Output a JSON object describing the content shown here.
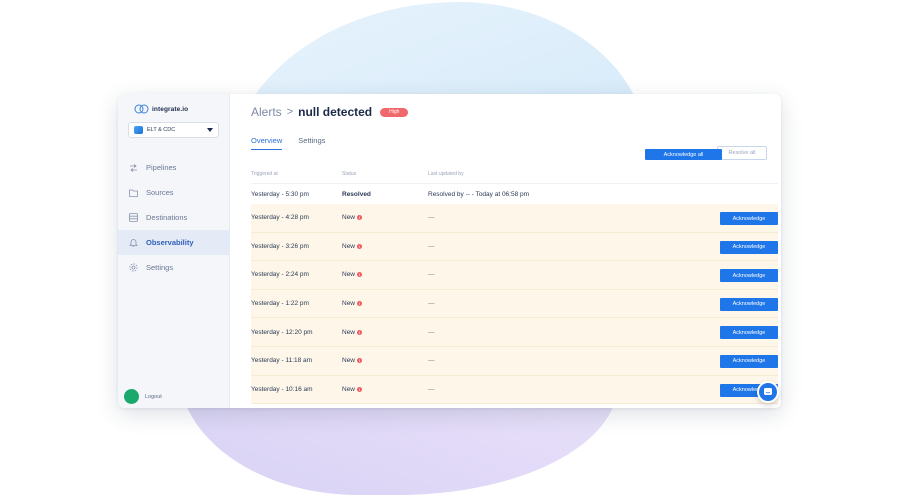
{
  "brand": {
    "logo_text": "integrate.io"
  },
  "workspace": {
    "selected": "ELT & CDC"
  },
  "sidebar": {
    "items": [
      {
        "label": "Pipelines",
        "icon": "pipelines-icon",
        "active": false
      },
      {
        "label": "Sources",
        "icon": "folder-icon",
        "active": false
      },
      {
        "label": "Destinations",
        "icon": "database-icon",
        "active": false
      },
      {
        "label": "Observability",
        "icon": "bell-icon",
        "active": true
      },
      {
        "label": "Settings",
        "icon": "gear-icon",
        "active": false
      }
    ],
    "logout_label": "Logout"
  },
  "header": {
    "breadcrumb_parent": "Alerts",
    "breadcrumb_separator": ">",
    "title": "null detected",
    "severity_badge": "High"
  },
  "tabs": [
    {
      "label": "Overview",
      "active": true
    },
    {
      "label": "Settings",
      "active": false
    }
  ],
  "actions": {
    "acknowledge_all": "Acknowledge all",
    "resolve_all": "Resolve all"
  },
  "table": {
    "columns": [
      "Triggered at",
      "Status",
      "Last updated by"
    ],
    "resolved_row": {
      "triggered_at": "Yesterday - 5:30 pm",
      "status": "Resolved",
      "last_updated_by": "Resolved by -- - Today at 06:58 pm"
    },
    "rows": [
      {
        "triggered_at": "Yesterday - 4:28 pm",
        "status": "New",
        "last_updated_by": "—",
        "action": "Acknowledge"
      },
      {
        "triggered_at": "Yesterday - 3:26 pm",
        "status": "New",
        "last_updated_by": "—",
        "action": "Acknowledge"
      },
      {
        "triggered_at": "Yesterday - 2:24 pm",
        "status": "New",
        "last_updated_by": "—",
        "action": "Acknowledge"
      },
      {
        "triggered_at": "Yesterday - 1:22 pm",
        "status": "New",
        "last_updated_by": "—",
        "action": "Acknowledge"
      },
      {
        "triggered_at": "Yesterday - 12:20 pm",
        "status": "New",
        "last_updated_by": "—",
        "action": "Acknowledge"
      },
      {
        "triggered_at": "Yesterday - 11:18 am",
        "status": "New",
        "last_updated_by": "—",
        "action": "Acknowledge"
      },
      {
        "triggered_at": "Yesterday - 10:16 am",
        "status": "New",
        "last_updated_by": "—",
        "action": "Acknowledge"
      }
    ],
    "new_badge_symbol": "!"
  },
  "colors": {
    "primary": "#1f76e8",
    "badge_high": "#f0686b",
    "row_highlight": "#fdf6e9",
    "active_nav_bg": "#e4ebf7",
    "avatar": "#1aa86b"
  }
}
